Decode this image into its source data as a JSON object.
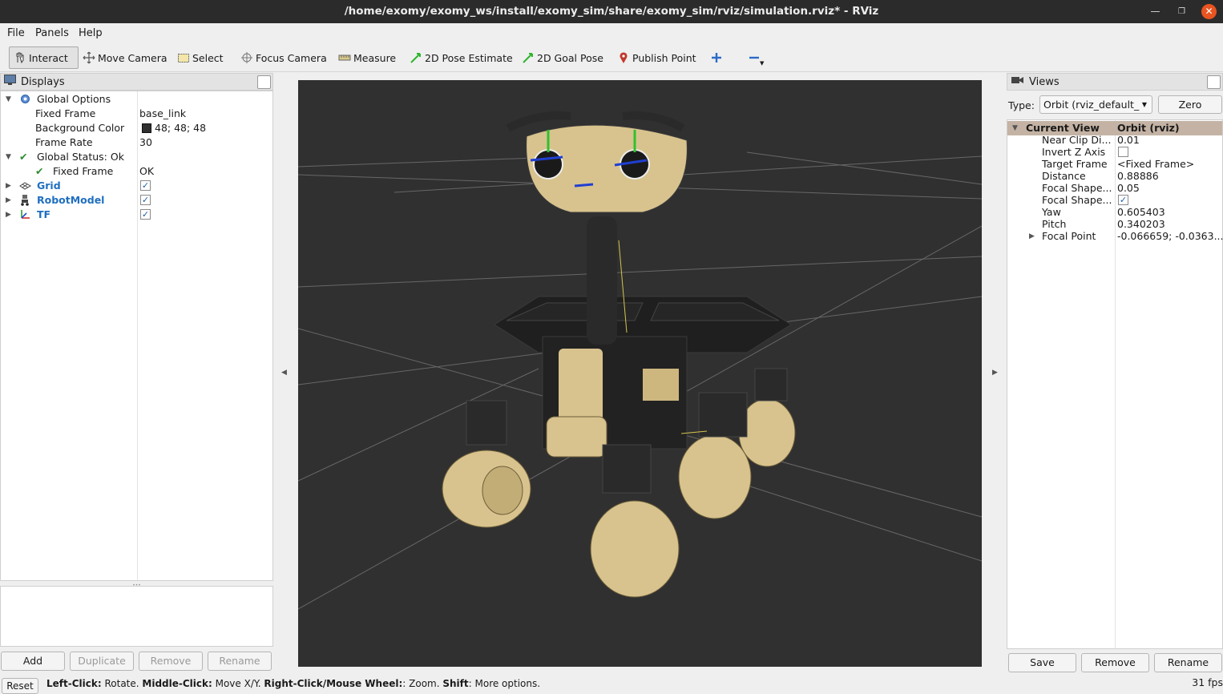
{
  "window": {
    "title": "/home/exomy/exomy_ws/install/exomy_sim/share/exomy_sim/rviz/simulation.rviz* - RViz"
  },
  "menu": [
    "File",
    "Panels",
    "Help"
  ],
  "toolbar": {
    "interact": "Interact",
    "move_camera": "Move Camera",
    "select": "Select",
    "focus_camera": "Focus Camera",
    "measure": "Measure",
    "pose_estimate": "2D Pose Estimate",
    "goal_pose": "2D Goal Pose",
    "publish_point": "Publish Point"
  },
  "displays": {
    "title": "Displays",
    "global_options": "Global Options",
    "fixed_frame_label": "Fixed Frame",
    "fixed_frame_value": "base_link",
    "background_color_label": "Background Color",
    "background_color_value": "48; 48; 48",
    "background_color_swatch": "#303030",
    "frame_rate_label": "Frame Rate",
    "frame_rate_value": "30",
    "global_status": "Global Status: Ok",
    "status_fixed_frame_label": "Fixed Frame",
    "status_fixed_frame_value": "OK",
    "items": [
      {
        "label": "Grid",
        "checked": true
      },
      {
        "label": "RobotModel",
        "checked": true
      },
      {
        "label": "TF",
        "checked": true
      }
    ],
    "buttons": {
      "add": "Add",
      "duplicate": "Duplicate",
      "remove": "Remove",
      "rename": "Rename"
    }
  },
  "views": {
    "title": "Views",
    "type_label": "Type:",
    "type_value": "Orbit (rviz_default_",
    "zero_button": "Zero",
    "current_view_label": "Current View",
    "current_view_value": "Orbit (rviz)",
    "properties": [
      {
        "key": "Near Clip Di...",
        "value": "0.01"
      },
      {
        "key": "Invert Z Axis",
        "value": ""
      },
      {
        "key": "Target Frame",
        "value": "<Fixed Frame>"
      },
      {
        "key": "Distance",
        "value": "0.88886"
      },
      {
        "key": "Focal Shape...",
        "value": "0.05"
      },
      {
        "key": "Focal Shape...",
        "value": ""
      },
      {
        "key": "Yaw",
        "value": "0.605403"
      },
      {
        "key": "Pitch",
        "value": "0.340203"
      },
      {
        "key": "Focal Point",
        "value": "-0.066659; -0.0363..."
      }
    ],
    "buttons": {
      "save": "Save",
      "remove": "Remove",
      "rename": "Rename"
    }
  },
  "status": {
    "reset": "Reset",
    "hint_1_key": "Left-Click:",
    "hint_1_val": " Rotate. ",
    "hint_2_key": "Middle-Click:",
    "hint_2_val": " Move X/Y. ",
    "hint_3_key": "Right-Click/Mouse Wheel:",
    "hint_3_val": ": Zoom. ",
    "hint_4_key": "Shift",
    "hint_4_val": ": More options.",
    "fps": "31 fps"
  },
  "colors": {
    "viewport_bg": "#303030",
    "robot_body": "#d8c38e",
    "robot_dark": "#2a2a2a",
    "accent_blue": "#1f6fbf"
  }
}
